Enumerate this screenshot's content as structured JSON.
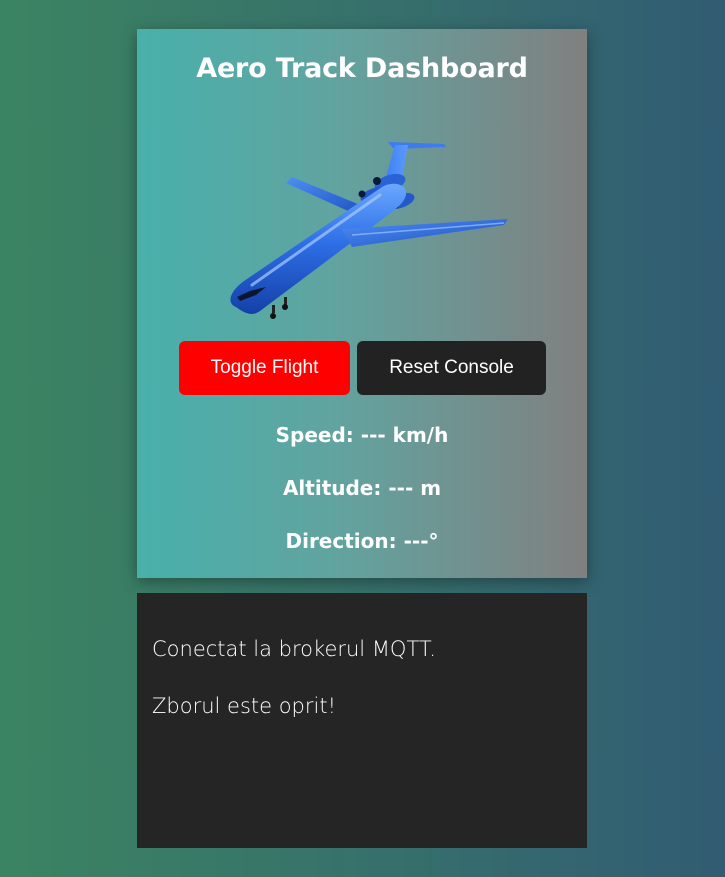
{
  "dashboard": {
    "title": "Aero Track Dashboard",
    "image_icon": "airplane-icon",
    "buttons": {
      "toggle_label": "Toggle Flight",
      "reset_label": "Reset Console",
      "toggle_color": "#ff0000",
      "reset_color": "#222222"
    },
    "stats": {
      "speed_label": "Speed:",
      "speed_value": "--- km/h",
      "altitude_label": "Altitude:",
      "altitude_value": "--- m",
      "direction_label": "Direction:",
      "direction_value": "---°"
    }
  },
  "console": {
    "lines": [
      "Conectat la brokerul MQTT.",
      "Zborul este oprit!"
    ]
  },
  "colors": {
    "page_bg_left": "#3b8462",
    "page_bg_right": "#315c73",
    "card_bg_left": "#48b0ab",
    "card_bg_right": "#808080",
    "console_bg": "#252525",
    "plane_blue": "#2a6fe0"
  }
}
